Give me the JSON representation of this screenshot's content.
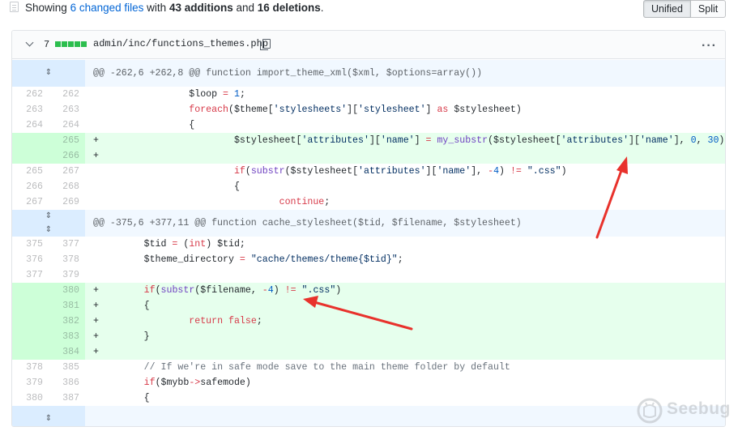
{
  "summary": {
    "prefix": "Showing",
    "changed_files": "6 changed files",
    "with": "with",
    "additions": "43 additions",
    "and": "and",
    "deletions": "16 deletions",
    "suffix": "."
  },
  "view_toggle": {
    "unified_label": "Unified",
    "split_label": "Split",
    "selected": "Unified"
  },
  "file": {
    "changes_count": "7",
    "path": "admin/inc/functions_themes.php",
    "diffstat_color": "#2cbe4e"
  },
  "hunks": [
    {
      "header": "@@ -262,6 +262,8 @@ function import_theme_xml($xml, $options=array())"
    },
    {
      "header": "@@ -375,6 +377,11 @@ function cache_stylesheet($tid, $filename, $stylesheet)"
    }
  ],
  "lines": [
    {
      "old": "262",
      "new": "262",
      "sign": " ",
      "text": "                $loop = 1;"
    },
    {
      "old": "263",
      "new": "263",
      "sign": " ",
      "text": "                foreach($theme['stylesheets']['stylesheet'] as $stylesheet)"
    },
    {
      "old": "264",
      "new": "264",
      "sign": " ",
      "text": "                {"
    },
    {
      "old": "",
      "new": "265",
      "sign": "+",
      "text": "                        $stylesheet['attributes']['name'] = my_substr($stylesheet['attributes']['name'], 0, 30);"
    },
    {
      "old": "",
      "new": "266",
      "sign": "+",
      "text": ""
    },
    {
      "old": "265",
      "new": "267",
      "sign": " ",
      "text": "                        if(substr($stylesheet['attributes']['name'], -4) != \".css\")"
    },
    {
      "old": "266",
      "new": "268",
      "sign": " ",
      "text": "                        {"
    },
    {
      "old": "267",
      "new": "269",
      "sign": " ",
      "text": "                                continue;"
    },
    {
      "old": "375",
      "new": "377",
      "sign": " ",
      "text": "        $tid = (int) $tid;"
    },
    {
      "old": "376",
      "new": "378",
      "sign": " ",
      "text": "        $theme_directory = \"cache/themes/theme{$tid}\";"
    },
    {
      "old": "377",
      "new": "379",
      "sign": " ",
      "text": ""
    },
    {
      "old": "",
      "new": "380",
      "sign": "+",
      "text": "        if(substr($filename, -4) != \".css\")"
    },
    {
      "old": "",
      "new": "381",
      "sign": "+",
      "text": "        {"
    },
    {
      "old": "",
      "new": "382",
      "sign": "+",
      "text": "                return false;"
    },
    {
      "old": "",
      "new": "383",
      "sign": "+",
      "text": "        }"
    },
    {
      "old": "",
      "new": "384",
      "sign": "+",
      "text": ""
    },
    {
      "old": "378",
      "new": "385",
      "sign": " ",
      "text": "        // If we're in safe mode save to the main theme folder by default"
    },
    {
      "old": "379",
      "new": "386",
      "sign": " ",
      "text": "        if($mybb->safemode)"
    },
    {
      "old": "380",
      "new": "387",
      "sign": " ",
      "text": "        {"
    }
  ],
  "watermark": "Seebug",
  "colors": {
    "addition_line_bg": "#e6ffed",
    "addition_num_bg": "#cdffd8",
    "hunk_bg": "#f1f8ff",
    "hunk_expand_bg": "#dbedff",
    "annotation_arrow": "#e8322c",
    "link": "#0366d6"
  },
  "icons": {
    "file_summary": "file-diff-icon",
    "collapse": "chevron-down-icon",
    "copy_path": "clippy-icon",
    "more": "kebab-horizontal-icon",
    "expand": "unfold-icon"
  }
}
